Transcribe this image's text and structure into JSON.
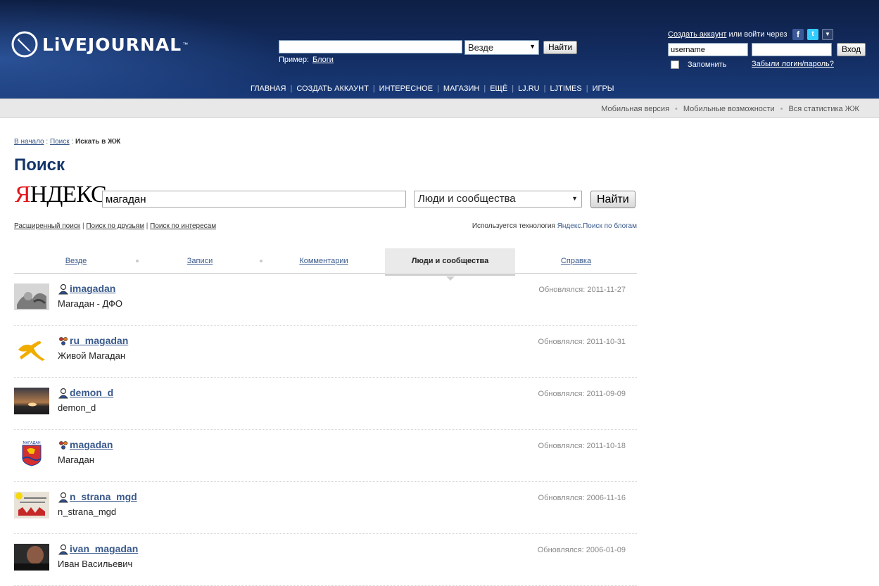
{
  "header": {
    "logo_text": "LiVEJOURNAL",
    "logo_tm": "™",
    "search_placeholder": "",
    "search_scope": "Везде",
    "search_button": "Найти",
    "example_label": "Пример:",
    "example_link": "Блоги",
    "login": {
      "create_account": "Создать аккаунт",
      "or_login_via": "или войти через",
      "facebook_glyph": "f",
      "twitter_glyph": "t",
      "more_glyph": "▼",
      "username_value": "username",
      "password_value": "",
      "login_button": "Вход",
      "remember": "Запомнить",
      "forgot": "Забыли логин/пароль?"
    },
    "nav": [
      "ГЛАВНАЯ",
      "СОЗДАТЬ АККАУНТ",
      "ИНТЕРЕСНОЕ",
      "МАГАЗИН",
      "ЕЩЁ",
      "LJ.RU",
      "LJTIMES",
      "ИГРЫ"
    ]
  },
  "subbar": [
    "Мобильная версия",
    "Мобильные возможности",
    "Вся статистика ЖЖ"
  ],
  "breadcrumb": {
    "home": "В начало",
    "sep": ":",
    "search": "Поиск",
    "current": "Искать в ЖЖ"
  },
  "page_title": "Поиск",
  "yandex": {
    "first": "Я",
    "rest": "НДЕКС"
  },
  "search": {
    "query": "магадан",
    "scope": "Люди и сообщества",
    "button": "Найти",
    "links": [
      "Расширенный поиск",
      "Поиск по друзьям",
      "Поиск по интересам"
    ],
    "link_sep": "|",
    "tech_prefix": "Используется технология",
    "tech_link": "Яндекс.Поиск по блогам"
  },
  "tabs": [
    "Везде",
    "Записи",
    "Комментарии",
    "Люди и сообщества",
    "Справка"
  ],
  "results": [
    {
      "name": "imagadan",
      "desc": "Магадан - ДФО",
      "updated": "Обновлялся: 2011-11-27",
      "kind": "user"
    },
    {
      "name": "ru_magadan",
      "desc": "Живой Магадан",
      "updated": "Обновлялся: 2011-10-31",
      "kind": "community"
    },
    {
      "name": "demon_d",
      "desc": "demon_d",
      "updated": "Обновлялся: 2011-09-09",
      "kind": "user"
    },
    {
      "name": "magadan",
      "desc": "Магадан",
      "updated": "Обновлялся: 2011-10-18",
      "kind": "community"
    },
    {
      "name": "n_strana_mgd",
      "desc": "n_strana_mgd",
      "updated": "Обновлялся: 2006-11-16",
      "kind": "user"
    },
    {
      "name": "ivan_magadan",
      "desc": "Иван Васильевич",
      "updated": "Обновлялся: 2006-01-09",
      "kind": "user"
    }
  ],
  "colors": {
    "header": "#122a5c",
    "link": "#3a5a8c",
    "title": "#15366b",
    "yandex_red": "#e4161a"
  }
}
